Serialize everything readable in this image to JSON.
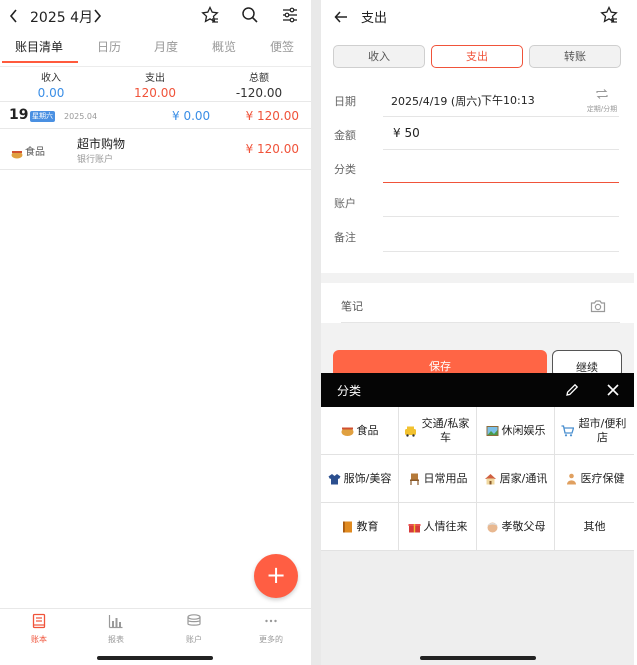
{
  "left": {
    "header": {
      "month": "2025 4月"
    },
    "tabs": [
      {
        "label": "账目清单"
      },
      {
        "label": "日历"
      },
      {
        "label": "月度"
      },
      {
        "label": "概览"
      },
      {
        "label": "便签"
      }
    ],
    "summary": {
      "income_label": "收入",
      "income_value": "0.00",
      "expense_label": "支出",
      "expense_value": "120.00",
      "total_label": "总额",
      "total_value": "-120.00"
    },
    "day": {
      "day": "19",
      "weekday": "星期六",
      "date": "2025.04",
      "income": "¥ 0.00",
      "expense": "¥ 120.00"
    },
    "transaction": {
      "category": "食品",
      "title": "超市购物",
      "account": "银行账户",
      "amount": "¥ 120.00"
    },
    "fab_label": "+",
    "nav": [
      {
        "label": "账本"
      },
      {
        "label": "报表"
      },
      {
        "label": "账户"
      },
      {
        "label": "更多的"
      }
    ]
  },
  "right": {
    "title": "支出",
    "segments": [
      {
        "label": "收入"
      },
      {
        "label": "支出"
      },
      {
        "label": "转账"
      }
    ],
    "form": {
      "date_label": "日期",
      "date_value": "2025/4/19 (周六)",
      "time_value": "下午10:13",
      "repeat_label": "定期/分期",
      "amount_label": "金额",
      "amount_value": "¥  50",
      "category_label": "分类",
      "account_label": "账户",
      "memo_label": "备注"
    },
    "notes_label": "笔记",
    "save_label": "保存",
    "continue_label": "继续",
    "category_panel": {
      "title": "分类",
      "items": [
        {
          "label": "食品",
          "icon": "food-icon",
          "color": "#e0a040"
        },
        {
          "label": "交通/私家车",
          "icon": "taxi-icon",
          "color": "#f2c230"
        },
        {
          "label": "休闲娱乐",
          "icon": "picture-icon",
          "color": "#5aa0d8"
        },
        {
          "label": "超市/便利店",
          "icon": "cart-icon",
          "color": "#4a8fcf"
        },
        {
          "label": "服饰/美容",
          "icon": "coat-icon",
          "color": "#2b4f8f"
        },
        {
          "label": "日常用品",
          "icon": "chair-icon",
          "color": "#b57a3a"
        },
        {
          "label": "居家/通讯",
          "icon": "house-icon",
          "color": "#d06040"
        },
        {
          "label": "医疗保健",
          "icon": "person-icon",
          "color": "#e0a060"
        },
        {
          "label": "教育",
          "icon": "book-icon",
          "color": "#e08a20"
        },
        {
          "label": "人情往来",
          "icon": "gift-icon",
          "color": "#d63a3a"
        },
        {
          "label": "孝敬父母",
          "icon": "elder-icon",
          "color": "#e8b890"
        },
        {
          "label": "其他",
          "icon": "",
          "color": ""
        }
      ]
    }
  }
}
